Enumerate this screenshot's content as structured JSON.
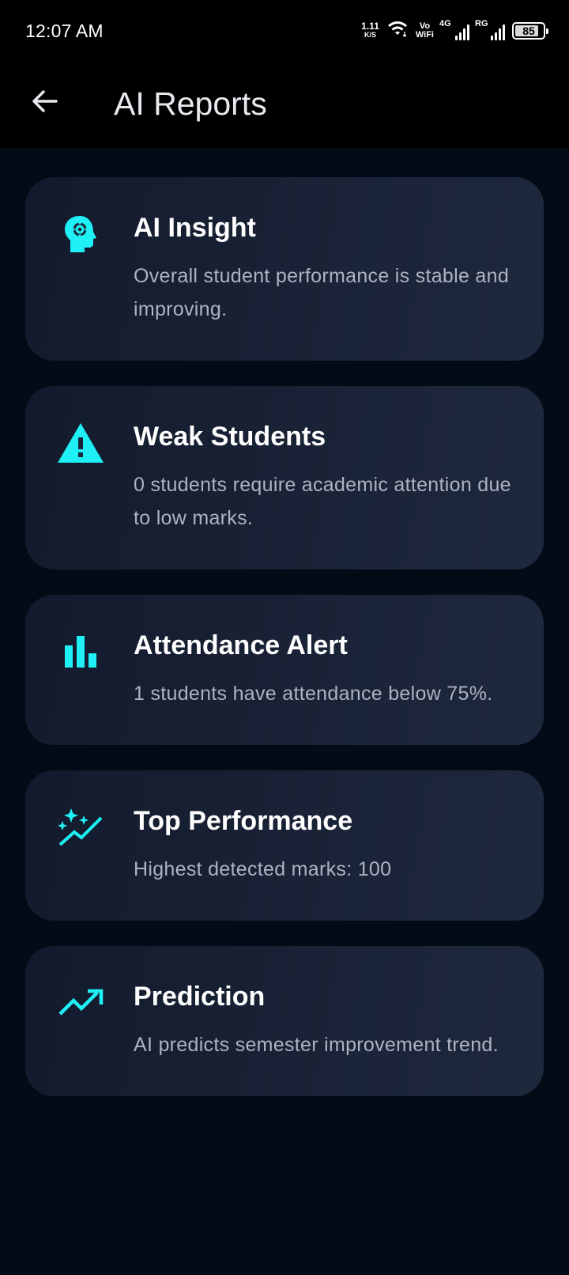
{
  "status_bar": {
    "time": "12:07 AM",
    "net_speed": "1.11",
    "net_unit": "K/S",
    "vo_label": "Vo",
    "wifi_label": "WiFi",
    "network_type": "4G",
    "sim2_label": "RG",
    "battery": "85",
    "battery_level": 0.85,
    "icons": [
      "wifi-icon",
      "signal-icon",
      "battery-icon"
    ]
  },
  "app_bar": {
    "title": "AI Reports",
    "back_icon": "arrow-back-icon"
  },
  "accent_color": "#1ef0f5",
  "cards": [
    {
      "icon": "psychology-head-icon",
      "title": "AI Insight",
      "description": "Overall student performance is stable and improving."
    },
    {
      "icon": "warning-triangle-icon",
      "title": "Weak Students",
      "description": "0 students require academic attention due to low marks."
    },
    {
      "icon": "bar-chart-icon",
      "title": "Attendance Alert",
      "description": "1 students have attendance below 75%."
    },
    {
      "icon": "auto-graph-sparkle-icon",
      "title": "Top Performance",
      "description": "Highest detected marks: 100"
    },
    {
      "icon": "trending-up-icon",
      "title": "Prediction",
      "description": "AI predicts semester improvement trend."
    }
  ]
}
